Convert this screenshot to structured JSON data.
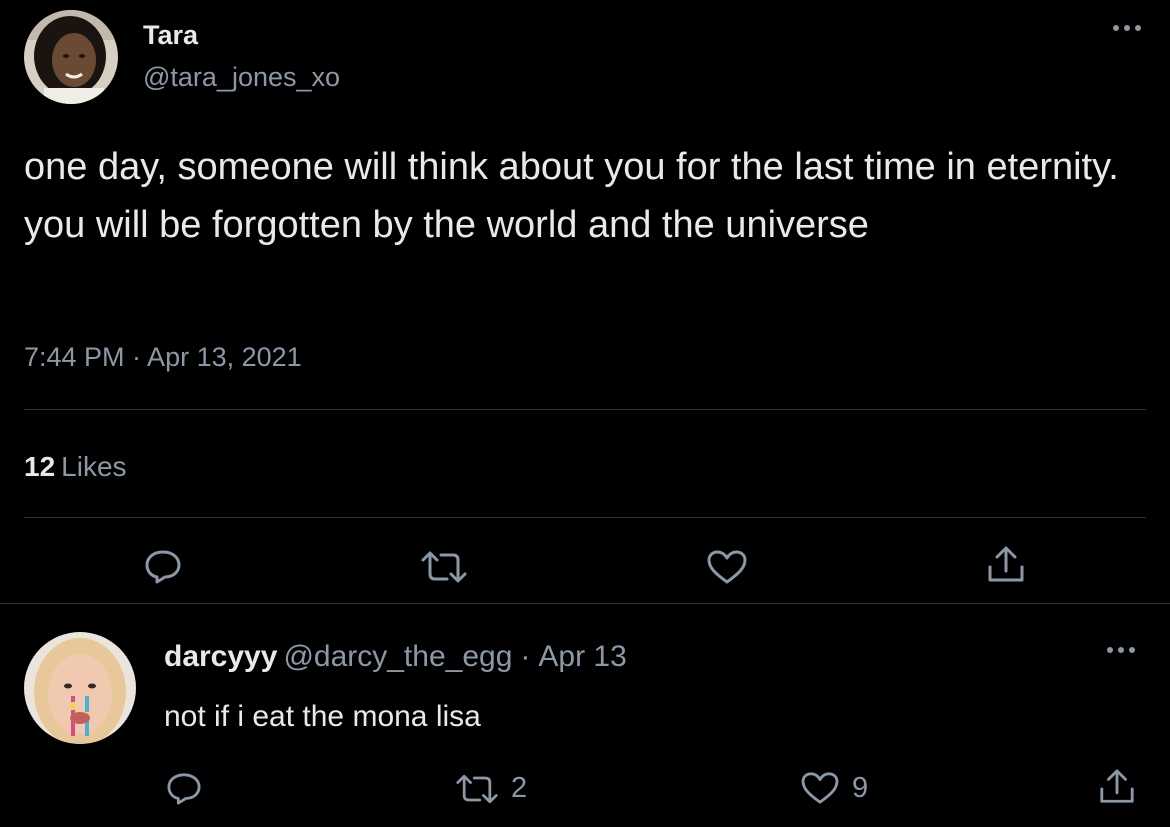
{
  "colors": {
    "background": "#000000",
    "primary_text": "#e7e9ea",
    "secondary_text": "#8b98a5",
    "divider": "#2f3336"
  },
  "tweet": {
    "author_name": "Tara",
    "author_handle": "@tara_jones_xo",
    "text": "one day, someone will think about you for the last time in eternity. you will be forgotten by the world and the universe",
    "timestamp": "7:44 PM · Apr 13, 2021",
    "likes_count": "12",
    "likes_label": "Likes",
    "icons": {
      "reply": "reply-icon",
      "retweet": "retweet-icon",
      "like": "heart-icon",
      "share": "share-icon",
      "more": "more-icon"
    }
  },
  "reply": {
    "author_name": "darcyyy",
    "author_handle": "@darcy_the_egg",
    "separator": "·",
    "date": "Apr 13",
    "text": "not if i eat the mona lisa",
    "retweet_count": "2",
    "like_count": "9"
  }
}
